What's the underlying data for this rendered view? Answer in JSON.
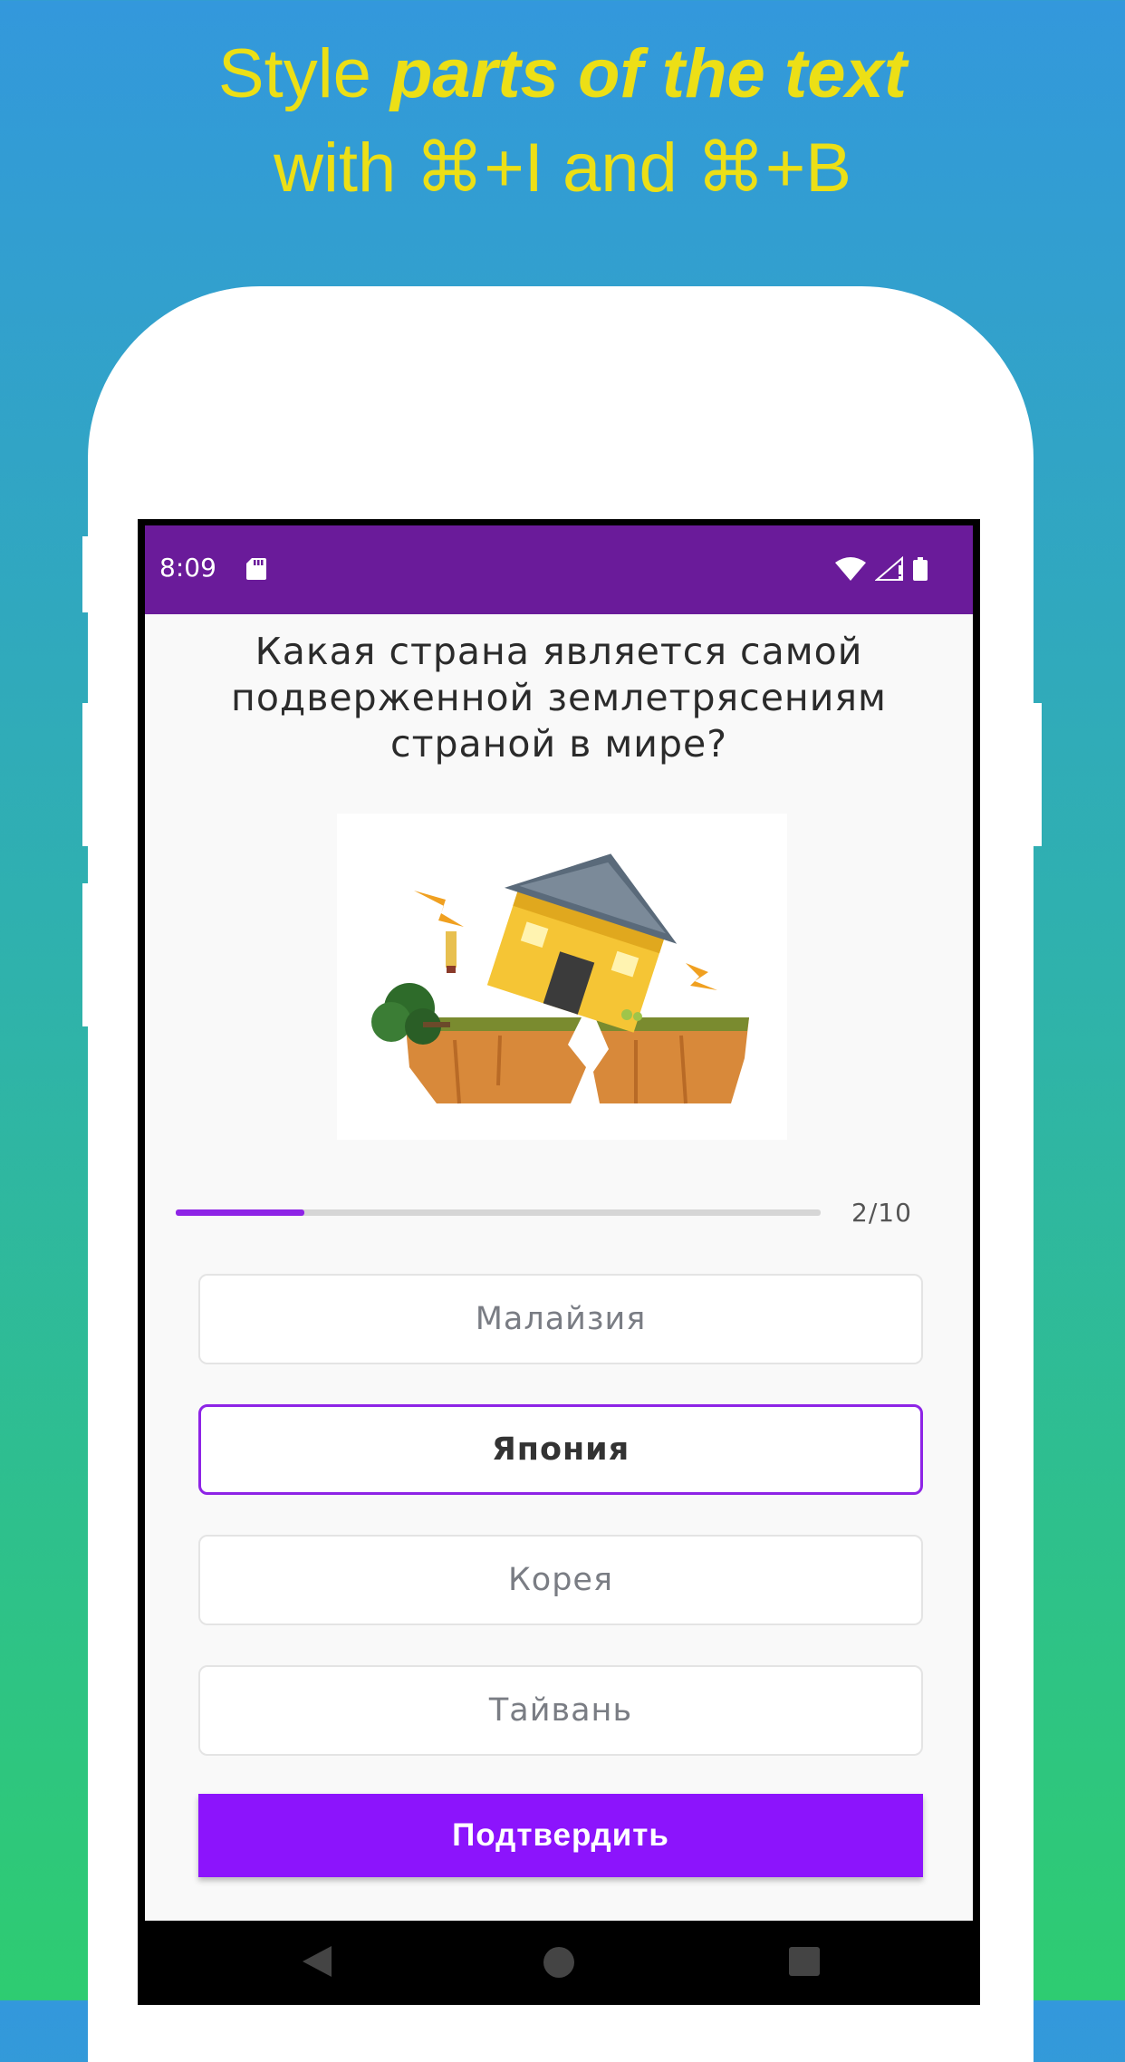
{
  "promo": {
    "line1_plain": "Style ",
    "line1_emph": "parts of the text",
    "line2": "with ⌘+I and ⌘+B"
  },
  "status_bar": {
    "time": "8:09",
    "icons": [
      "sd-card-icon",
      "wifi-icon",
      "signal-icon",
      "battery-icon"
    ],
    "background": "#6a1b9a"
  },
  "quiz": {
    "question": "Какая страна является самой подверженной землетрясениям страной в мире?",
    "progress": {
      "label": "2/10",
      "fraction": 0.2
    },
    "answers": [
      {
        "label": "Малайзия",
        "selected": false
      },
      {
        "label": "Япония",
        "selected": true
      },
      {
        "label": "Корея",
        "selected": false
      },
      {
        "label": "Тайвань",
        "selected": false
      }
    ],
    "confirm_label": "Подтвердить"
  },
  "colors": {
    "accent": "#8c14fc",
    "headline": "#ecdf16",
    "progress": "#8e24e6"
  },
  "nav_bar": {
    "buttons": [
      "back-icon",
      "home-icon",
      "recents-icon"
    ]
  }
}
